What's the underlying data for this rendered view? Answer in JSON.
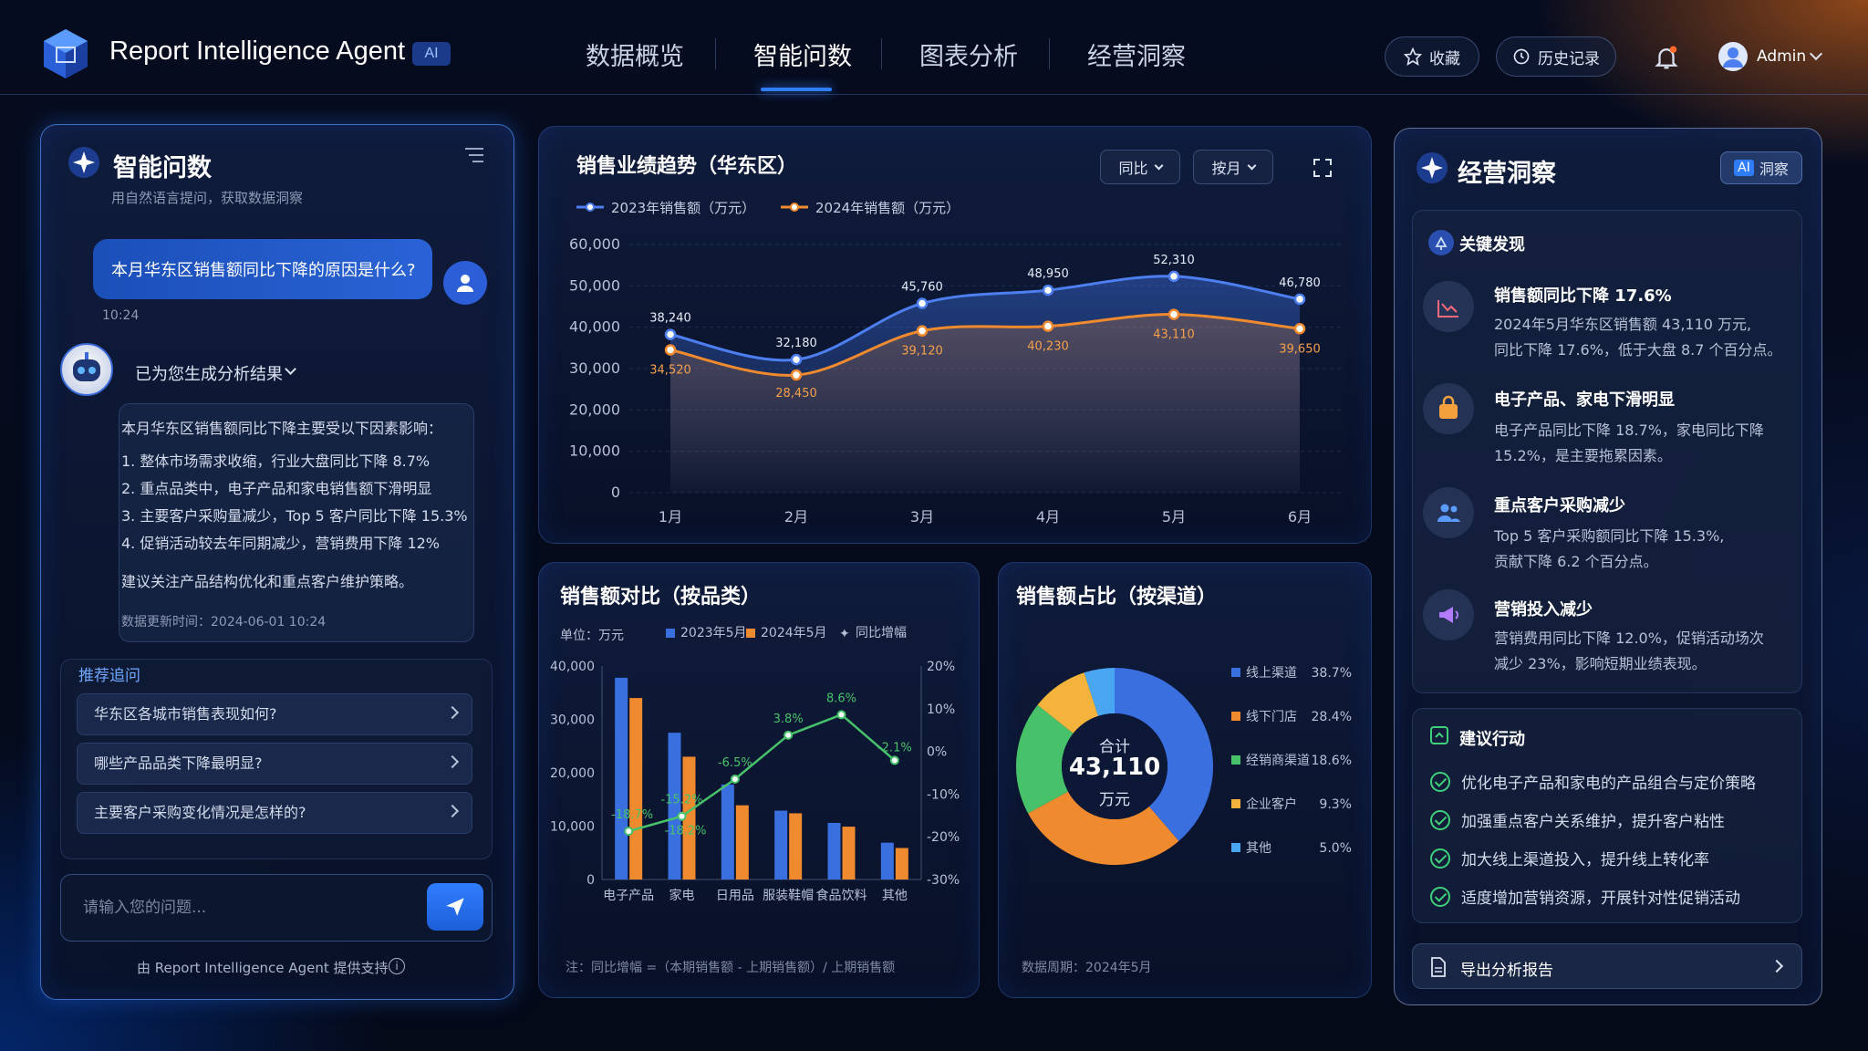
{
  "app": {
    "title": "Report Intelligence Agent",
    "ai_badge": "AI"
  },
  "nav": {
    "tabs": [
      {
        "label": "数据概览"
      },
      {
        "label": "智能问数"
      },
      {
        "label": "图表分析"
      },
      {
        "label": "经营洞察"
      }
    ],
    "active": "智能问数"
  },
  "header": {
    "favorite": "收藏",
    "history": "历史记录",
    "user": "Admin"
  },
  "icons": [
    "logo-icon",
    "star-icon",
    "clock-icon",
    "bell-icon",
    "avatar-icon",
    "sparkle-icon",
    "filter-icon",
    "send-icon",
    "robot-icon",
    "expand-icon",
    "info-icon"
  ],
  "colors": {
    "accent": "#2e7dff",
    "series2023": "#4d7ff0",
    "series2024": "#f08a2e",
    "growth": "#47c26a",
    "notification": "#ff6a2a"
  },
  "chat": {
    "title": "智能问数",
    "subtitle": "用自然语言提问，获取数据洞察",
    "user_question": "本月华东区销售额同比下降的原因是什么?",
    "time": "10:24",
    "bot_header": "已为您生成分析结果",
    "answer_intro": "本月华东区销售额同比下降主要受以下因素影响：",
    "answer_points": [
      "1. 整体市场需求收缩，行业大盘同比下降 8.7%",
      "2. 重点品类中，电子产品和家电销售额下滑明显",
      "3. 主要客户采购量减少，Top 5 客户同比下降 15.3%",
      "4. 促销活动较去年同期减少，营销费用下降 12%"
    ],
    "answer_advice": "建议关注产品结构优化和重点客户维护策略。",
    "updated": "数据更新时间：2024-06-01 10:24",
    "suggest_title": "推荐追问",
    "suggestions": [
      "华东区各城市销售表现如何?",
      "哪些产品品类下降最明显?",
      "主要客户采购变化情况是怎样的?"
    ],
    "input_placeholder": "请输入您的问题...",
    "footer": "由 Report Intelligence Agent 提供支持"
  },
  "trend_panel": {
    "title": "销售业绩趋势（华东区）",
    "dropdown1": "同比",
    "dropdown2": "按月"
  },
  "bar_panel": {
    "title": "销售额对比（按品类）",
    "unit": "单位：万元",
    "note": "注：同比增幅 =（本期销售额 - 上期销售额）/ 上期销售额"
  },
  "pie_panel": {
    "title": "销售额占比（按渠道）",
    "center_label": "合计",
    "center_value": "43,110",
    "center_unit": "万元",
    "period": "数据周期：2024年5月"
  },
  "insight": {
    "title": "经营洞察",
    "badge_ai": "AI",
    "badge_text": "洞察",
    "key_title": "关键发现",
    "findings": [
      {
        "icon": "trend-down-icon",
        "title": "销售额同比下降 17.6%",
        "lines": [
          "2024年5月华东区销售额 43,110 万元,",
          "同比下降 17.6%，低于大盘 8.7 个百分点。"
        ]
      },
      {
        "icon": "bag-icon",
        "title": "电子产品、家电下滑明显",
        "lines": [
          "电子产品同比下降 18.7%，家电同比下降",
          "15.2%，是主要拖累因素。"
        ]
      },
      {
        "icon": "users-icon",
        "title": "重点客户采购减少",
        "lines": [
          "Top 5 客户采购额同比下降 15.3%,",
          "贡献下降 6.2 个百分点。"
        ]
      },
      {
        "icon": "megaphone-icon",
        "title": "营销投入减少",
        "lines": [
          "营销费用同比下降 12.0%，促销活动场次",
          "减少 23%，影响短期业绩表现。"
        ]
      }
    ],
    "action_title": "建议行动",
    "actions": [
      "优化电子产品和家电的产品组合与定价策略",
      "加强重点客户关系维护，提升客户粘性",
      "加大线上渠道投入，提升线上转化率",
      "适度增加营销资源，开展针对性促销活动"
    ],
    "export": "导出分析报告"
  },
  "chart_data": [
    {
      "type": "line",
      "title": "销售业绩趋势（华东区）",
      "x": [
        "1月",
        "2月",
        "3月",
        "4月",
        "5月",
        "6月"
      ],
      "series": [
        {
          "name": "2023年销售额（万元）",
          "values": [
            38240,
            32180,
            45760,
            48950,
            52310,
            46780
          ]
        },
        {
          "name": "2024年销售额（万元）",
          "values": [
            34520,
            28450,
            39120,
            40230,
            43110,
            39650
          ]
        }
      ],
      "value_labels": {
        "s2023": [
          "38,240",
          "32,180",
          "45,760",
          "48,950",
          "52,310",
          "46,780"
        ],
        "s2024": [
          "34,520",
          "28,450",
          "39,120",
          "40,230",
          "43,110",
          "39,650"
        ]
      },
      "ylim": [
        0,
        60000
      ],
      "yticks": [
        "0",
        "10,000",
        "20,000",
        "30,000",
        "40,000",
        "50,000",
        "60,000"
      ],
      "legend": "top-left",
      "grid": true
    },
    {
      "type": "bar",
      "title": "销售额对比（按品类）",
      "categories": [
        "电子产品",
        "家电",
        "日用品",
        "服装鞋帽",
        "食品饮料",
        "其他"
      ],
      "series": [
        {
          "name": "2023年5月",
          "values": [
            37800,
            27500,
            17800,
            12900,
            10600,
            6900
          ]
        },
        {
          "name": "2024年5月",
          "values": [
            34000,
            23000,
            13900,
            12400,
            9900,
            5900
          ]
        },
        {
          "name": "同比增幅",
          "type": "line",
          "values": [
            -18.7,
            -15.2,
            -6.5,
            3.8,
            8.6,
            -2.1
          ]
        }
      ],
      "growth_labels": [
        "-18.7%",
        "-15.2%",
        "-6.5%",
        "3.8%",
        "8.6%",
        "-2.1%"
      ],
      "growth_labels_alt": [
        "-18.2%"
      ],
      "ylim": [
        0,
        40000
      ],
      "yticks": [
        "0",
        "10,000",
        "20,000",
        "30,000",
        "40,000"
      ],
      "y2lim": [
        -30,
        20
      ],
      "y2ticks": [
        "-30%",
        "-20%",
        "-10%",
        "0%",
        "10%",
        "20%"
      ],
      "legend": "top"
    },
    {
      "type": "pie",
      "title": "销售额占比（按渠道）",
      "slices": [
        {
          "name": "线上渠道",
          "value": 38.7,
          "label": "38.7%",
          "color": "#3a6fe0"
        },
        {
          "name": "线下门店",
          "value": 28.4,
          "label": "28.4%",
          "color": "#f08a2e"
        },
        {
          "name": "经销商渠道",
          "value": 18.6,
          "label": "18.6%",
          "color": "#47c26a"
        },
        {
          "name": "企业客户",
          "value": 9.3,
          "label": "9.3%",
          "color": "#f3b33d"
        },
        {
          "name": "其他",
          "value": 5.0,
          "label": "5.0%",
          "color": "#49a6f2"
        }
      ],
      "legend": "right"
    }
  ]
}
